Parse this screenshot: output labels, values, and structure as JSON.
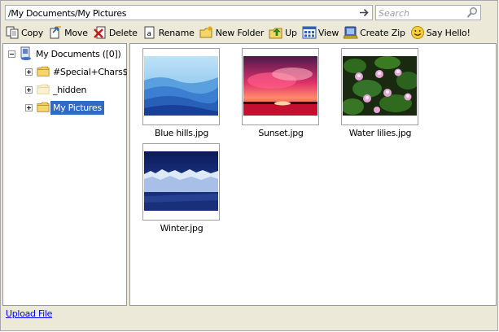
{
  "address": {
    "path": "/My Documents/My Pictures"
  },
  "search": {
    "placeholder": "Search"
  },
  "toolbar": {
    "copy": "Copy",
    "move": "Move",
    "delete": "Delete",
    "rename": "Rename",
    "new_folder": "New Folder",
    "up": "Up",
    "view": "View",
    "create_zip": "Create Zip",
    "say_hello": "Say Hello!"
  },
  "tree": {
    "root": "My Documents ([0])",
    "items": [
      {
        "label": "#Special+Chars$"
      },
      {
        "label": "_hidden"
      },
      {
        "label": "My Pictures"
      }
    ]
  },
  "files": [
    {
      "name": "Blue hills.jpg"
    },
    {
      "name": "Sunset.jpg"
    },
    {
      "name": "Water lilies.jpg"
    },
    {
      "name": "Winter.jpg"
    }
  ],
  "footer": {
    "upload": "Upload File"
  },
  "colors": {
    "selection": "#316ac5",
    "chrome": "#ece9d8",
    "link": "#0000ee"
  }
}
